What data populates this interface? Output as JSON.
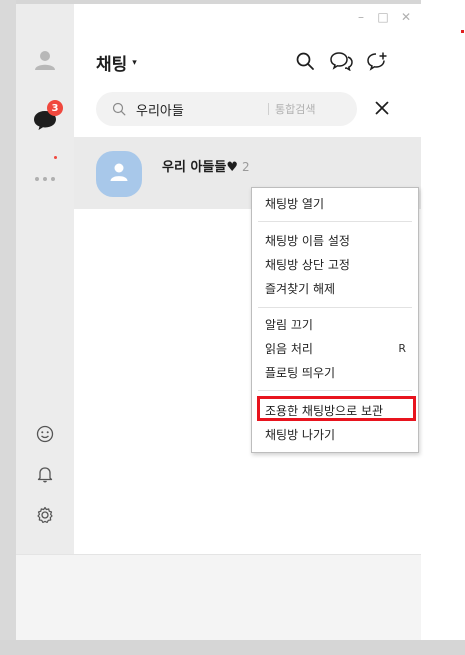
{
  "window": {
    "controls": [
      "–",
      "□",
      "✕"
    ]
  },
  "sidebar": {
    "chat_badge": "3",
    "items": [
      {
        "icon": "person-icon"
      },
      {
        "icon": "chat-bubble-icon"
      },
      {
        "icon": "more-dots-icon"
      },
      {
        "icon": "emoji-icon"
      },
      {
        "icon": "bell-icon"
      },
      {
        "icon": "settings-gear-icon"
      }
    ]
  },
  "header": {
    "title": "채팅",
    "caret": "▾"
  },
  "search": {
    "value": "우리아들",
    "scope_label": "통합검색"
  },
  "chat_list": [
    {
      "name": "우리 아들들♥",
      "member_count": "2"
    }
  ],
  "context_menu": {
    "items": [
      {
        "label": "채팅방 열기"
      },
      {
        "label": "채팅방 이름 설정"
      },
      {
        "label": "채팅방 상단 고정"
      },
      {
        "label": "즐겨찾기 해제"
      },
      {
        "label": "알림 끄기"
      },
      {
        "label": "읽음 처리",
        "shortcut": "R"
      },
      {
        "label": "플로팅 띄우기"
      },
      {
        "label": "조용한 채팅방으로 보관"
      },
      {
        "label": "채팅방 나가기"
      }
    ]
  },
  "colors": {
    "badge": "#f0483e",
    "highlight": "#e8141e",
    "avatar": "#a8c8ea"
  }
}
